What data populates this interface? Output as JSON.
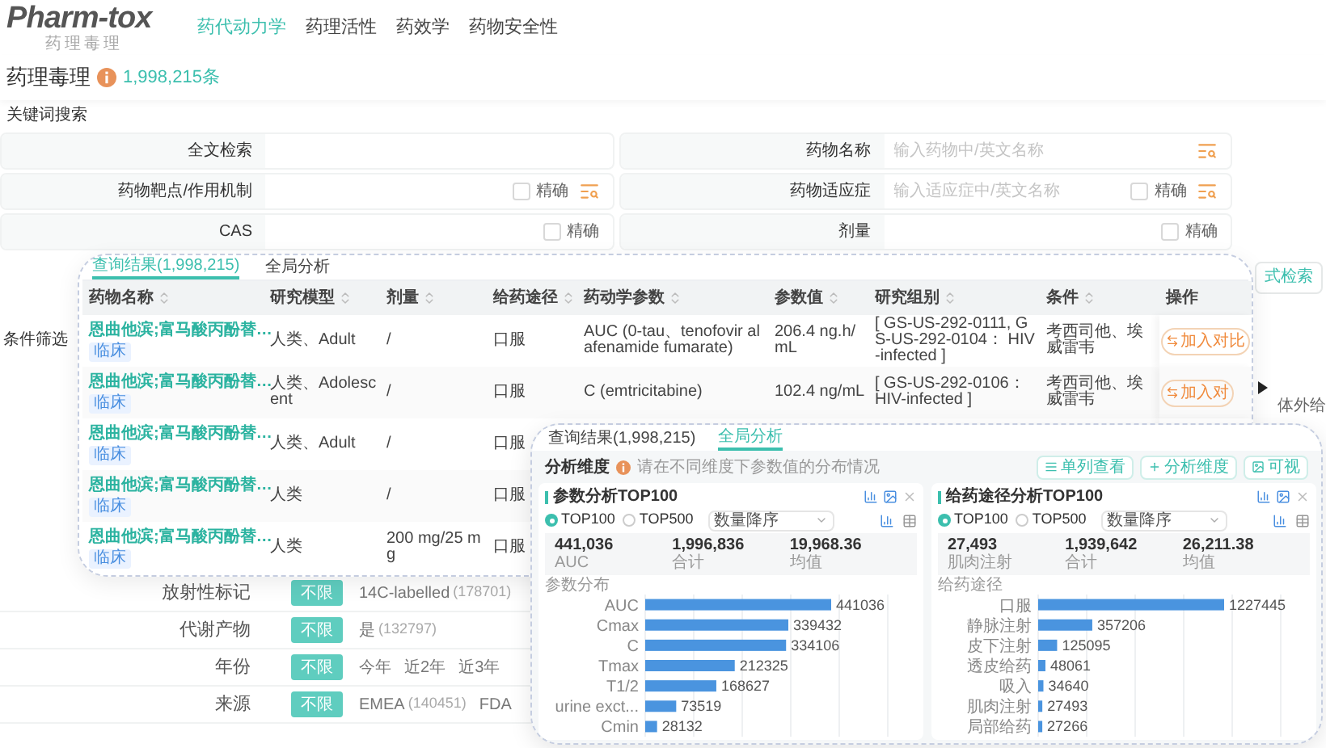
{
  "header": {
    "logo": "Pharm-tox",
    "logo_subtitle": "药理毒理",
    "nav": [
      {
        "label": "药代动力学",
        "selected": true
      },
      {
        "label": "药理活性",
        "selected": false
      },
      {
        "label": "药效学",
        "selected": false
      },
      {
        "label": "药物安全性",
        "selected": false
      }
    ]
  },
  "title": {
    "text": "药理毒理",
    "count": "1,998,215条"
  },
  "keyword_search": {
    "heading": "关键词搜索",
    "fields": [
      {
        "label": "全文检索",
        "lookup": false
      },
      {
        "label": "药物名称",
        "placeholder": "输入药物中/英文名称",
        "lookup": true
      },
      {
        "label": "药物靶点/作用机制",
        "exact": {
          "label": "精确",
          "checked": false
        },
        "lookup": true
      },
      {
        "label": "药物适应症",
        "placeholder": "输入适应症中/英文名称",
        "exact": {
          "label": "精确",
          "checked": false
        },
        "lookup": true
      },
      {
        "label": "CAS",
        "exact": {
          "label": "精确",
          "checked": false
        },
        "lookup": false
      },
      {
        "label": "剂量",
        "exact": {
          "label": "精确",
          "checked": false
        },
        "lookup": false
      }
    ]
  },
  "side_button": "式检索",
  "side_text": "体外给",
  "condition_filter": {
    "heading": "条件筛选",
    "rows": [
      {
        "label": "放射性标记",
        "options": [
          {
            "text": "不限",
            "selected": true
          },
          {
            "text": "14C-labelled",
            "count": "(178701)",
            "selected": false
          }
        ]
      },
      {
        "label": "代谢产物",
        "options": [
          {
            "text": "不限",
            "selected": true
          },
          {
            "text": "是",
            "count": "(132797)",
            "selected": false
          }
        ]
      },
      {
        "label": "年份",
        "options": [
          {
            "text": "不限",
            "selected": true
          },
          {
            "text": "今年",
            "selected": false
          },
          {
            "text": "近2年",
            "selected": false
          },
          {
            "text": "近3年",
            "selected": false
          }
        ]
      },
      {
        "label": "来源",
        "options": [
          {
            "text": "不限",
            "selected": true
          },
          {
            "text": "EMEA",
            "count": "(140451)",
            "selected": false
          },
          {
            "text": "FDA",
            "selected": false
          }
        ]
      }
    ]
  },
  "results_card": {
    "tabs": [
      {
        "label": "查询结果(1,998,215)",
        "selected": true
      },
      {
        "label": "全局分析",
        "selected": false
      }
    ],
    "columns": [
      "药物名称",
      "研究模型",
      "剂量",
      "给药途径",
      "药动学参数",
      "参数值",
      "研究组别",
      "条件",
      "操作"
    ],
    "rows": [
      {
        "cells": [
          "恩曲他滨;富马酸丙酚替…",
          "人类、Adult",
          "/",
          "口服",
          "AUC (0-tau、tenofovir alafenamide fumarate)",
          "206.4 ng.h/mL",
          "[ GS-US-292-0111, GS-US-292-0104： HIV-infected ]",
          "考西司他、埃威雷韦",
          "加入对比"
        ],
        "tag": "临床"
      },
      {
        "cells": [
          "恩曲他滨;富马酸丙酚替…",
          "人类、Adolescent",
          "/",
          "口服",
          "C (emtricitabine)",
          "102.4 ng/mL",
          "[ GS-US-292-0106： HIV-infected ]",
          "考西司他、埃威雷韦",
          "加入对"
        ],
        "tag": "临床"
      },
      {
        "cells": [
          "恩曲他滨;富马酸丙酚替…",
          "人类、Adult",
          "/",
          "口服"
        ],
        "tag": "临床"
      },
      {
        "cells": [
          "恩曲他滨;富马酸丙酚替…",
          "人类",
          "/",
          "口服"
        ],
        "tag": "临床"
      },
      {
        "cells": [
          "恩曲他滨;富马酸丙酚替…",
          "人类",
          "200 mg/25 mg",
          "口服"
        ],
        "tag": "临床"
      }
    ]
  },
  "analysis_card": {
    "tabs": [
      {
        "label": "查询结果(1,998,215)",
        "selected": false
      },
      {
        "label": "全局分析",
        "selected": true
      }
    ],
    "dimension_label": "分析维度",
    "note": "请在不同维度下参数值的分布情况",
    "buttons": [
      "单列查看",
      "分析维度",
      "可视"
    ],
    "panels": [
      {
        "title": "参数分析TOP100",
        "radios": [
          {
            "label": "TOP100",
            "selected": true
          },
          {
            "label": "TOP500",
            "selected": false
          }
        ],
        "sort": "数量降序",
        "stats": [
          {
            "value": "441,036",
            "label": "AUC"
          },
          {
            "value": "1,996,836",
            "label": "合计"
          },
          {
            "value": "19,968.36",
            "label": "均值"
          }
        ],
        "chart_data": {
          "type": "bar",
          "orientation": "horizontal",
          "title": "参数分布",
          "categories": [
            "AUC",
            "Cmax",
            "C",
            "Tmax",
            "T1/2",
            "urine exct...",
            "Cmin"
          ],
          "values": [
            441036,
            339432,
            334106,
            212325,
            168627,
            73519,
            28132
          ],
          "data_labels": true
        }
      },
      {
        "title": "给药途径分析TOP100",
        "radios": [
          {
            "label": "TOP100",
            "selected": true
          },
          {
            "label": "TOP500",
            "selected": false
          }
        ],
        "sort": "数量降序",
        "stats": [
          {
            "value": "27,493",
            "label": "肌肉注射"
          },
          {
            "value": "1,939,642",
            "label": "合计"
          },
          {
            "value": "26,211.38",
            "label": "均值"
          }
        ],
        "chart_data": {
          "type": "bar",
          "orientation": "horizontal",
          "title": "给药途径",
          "categories": [
            "口服",
            "静脉注射",
            "皮下注射",
            "透皮给药",
            "吸入",
            "肌肉注射",
            "局部给药"
          ],
          "values": [
            1227445,
            357206,
            125095,
            48061,
            34640,
            27493,
            27266
          ],
          "data_labels": true
        }
      }
    ]
  }
}
